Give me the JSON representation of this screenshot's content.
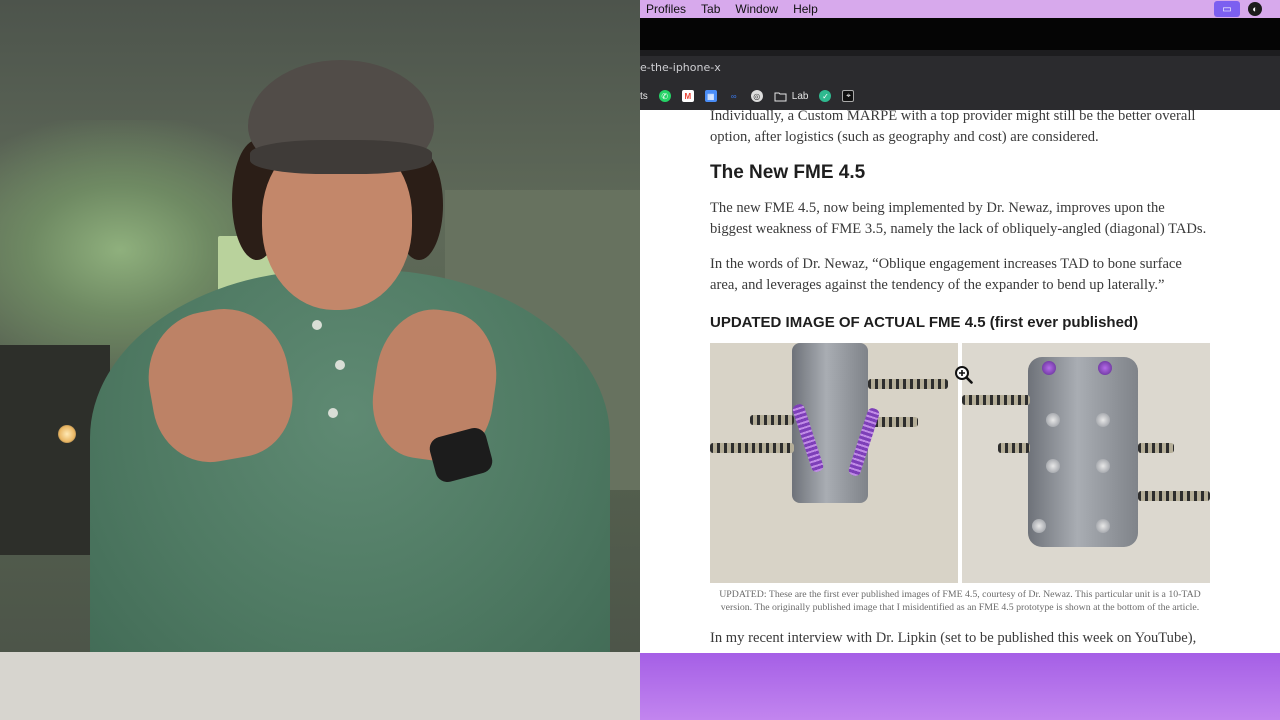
{
  "menubar": {
    "items": [
      "Profiles",
      "Tab",
      "Window",
      "Help"
    ]
  },
  "browser": {
    "url_fragment": "e-the-iphone-x",
    "bookmarks": [
      {
        "label": "ts",
        "icon": "truncated-bookmark"
      },
      {
        "label": "",
        "icon": "whatsapp-icon",
        "color": "#25d366"
      },
      {
        "label": "",
        "icon": "gmail-icon",
        "color": "#ea4335"
      },
      {
        "label": "",
        "icon": "calendar-icon",
        "color": "#4a8df6"
      },
      {
        "label": "",
        "icon": "link-icon",
        "color": "#3b7bf0"
      },
      {
        "label": "",
        "icon": "circle-icon",
        "color": "#dddddd"
      },
      {
        "label": "Lab",
        "icon": "folder-icon"
      },
      {
        "label": "",
        "icon": "check-circle-icon",
        "color": "#2fb98f"
      },
      {
        "label": "",
        "icon": "target-icon",
        "color": "#111111"
      }
    ]
  },
  "article": {
    "intro": "Individually, a Custom MARPE with a top provider might still be the better overall option, after logistics (such as geography and cost) are considered.",
    "heading": "The New FME 4.5",
    "para1": "The new FME 4.5, now being implemented by Dr. Newaz, improves upon the biggest weakness of FME 3.5, namely the lack of obliquely-angled (diagonal) TADs.",
    "para2": "In the words of Dr. Newaz, “Oblique engagement increases TAD to bone surface area, and leverages against the tendency of the expander to bend up laterally.”",
    "subheading": "UPDATED IMAGE OF ACTUAL FME 4.5 (first ever published)",
    "caption": "UPDATED: These are the first ever published images of FME 4.5, courtesy of Dr. Newaz. This particular unit is a 10-TAD version. The originally published image that I misidentified as an FME 4.5 prototype is shown at the bottom of the article.",
    "para3": "In my recent interview with Dr. Lipkin (set to be published this week on YouTube), he"
  },
  "colors": {
    "menubar": "#d7a9ec",
    "accent": "#7c5ff0",
    "lower_panel": "#b06cea"
  }
}
